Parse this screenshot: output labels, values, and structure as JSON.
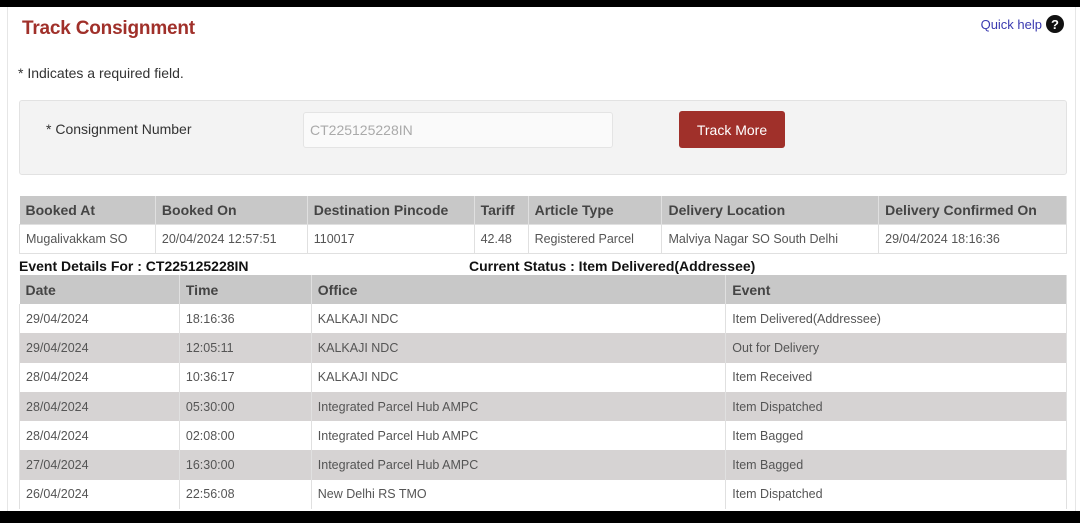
{
  "header": {
    "title": "Track Consignment",
    "quick_help_label": "Quick help",
    "help_icon_glyph": "?"
  },
  "required_note": "* Indicates a required field.",
  "form": {
    "consignment_label": "* Consignment Number",
    "consignment_value": "CT225125228IN",
    "track_more_label": "Track More"
  },
  "booking": {
    "columns": [
      "Booked At",
      "Booked On",
      "Destination Pincode",
      "Tariff",
      "Article Type",
      "Delivery Location",
      "Delivery Confirmed On"
    ],
    "row": [
      "Mugalivakkam SO",
      "20/04/2024 12:57:51",
      "110017",
      "42.48",
      "Registered Parcel",
      "Malviya Nagar SO South Delhi",
      "29/04/2024 18:16:36"
    ]
  },
  "event_details": {
    "heading": "Event Details For : CT225125228IN",
    "current_status": "Current Status : Item Delivered(Addressee)",
    "columns": [
      "Date",
      "Time",
      "Office",
      "Event"
    ],
    "rows": [
      [
        "29/04/2024",
        "18:16:36",
        "KALKAJI NDC",
        "Item Delivered(Addressee)"
      ],
      [
        "29/04/2024",
        "12:05:11",
        "KALKAJI NDC",
        "Out for Delivery"
      ],
      [
        "28/04/2024",
        "10:36:17",
        "KALKAJI NDC",
        "Item Received"
      ],
      [
        "28/04/2024",
        "05:30:00",
        "Integrated Parcel Hub AMPC",
        "Item Dispatched"
      ],
      [
        "28/04/2024",
        "02:08:00",
        "Integrated Parcel Hub AMPC",
        "Item Bagged"
      ],
      [
        "27/04/2024",
        "16:30:00",
        "Integrated Parcel Hub AMPC",
        "Item Bagged"
      ],
      [
        "26/04/2024",
        "22:56:08",
        "New Delhi RS TMO",
        "Item Dispatched"
      ]
    ]
  },
  "colors": {
    "brand_red": "#a0302a",
    "link_blue": "#3a3ab0",
    "table_header_bg": "#c8c8c8",
    "row_alt_bg": "#d6d3d3"
  }
}
